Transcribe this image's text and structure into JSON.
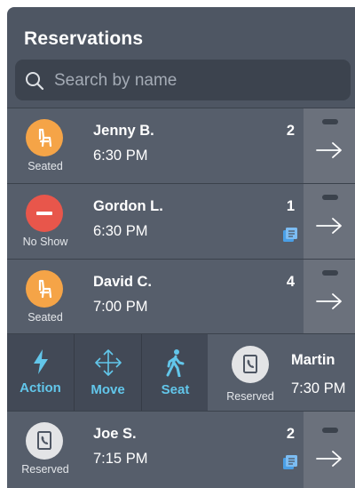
{
  "header": {
    "title": "Reservations"
  },
  "search": {
    "placeholder": "Search by name",
    "value": ""
  },
  "reservations": [
    {
      "name": "Jenny B.",
      "time": "6:30 PM",
      "party": "2",
      "status": "Seated",
      "status_icon": "chair-icon",
      "status_color": "#f5a447",
      "has_note": false
    },
    {
      "name": "Gordon L.",
      "time": "6:30 PM",
      "party": "1",
      "status": "No Show",
      "status_icon": "no-entry-icon",
      "status_color": "#e8564b",
      "has_note": true
    },
    {
      "name": "David C.",
      "time": "7:00 PM",
      "party": "4",
      "status": "Seated",
      "status_icon": "chair-icon",
      "status_color": "#f5a447",
      "has_note": false
    },
    {
      "name": "Joe S.",
      "time": "7:15 PM",
      "party": "2",
      "status": "Reserved",
      "status_icon": "phone-book-icon",
      "status_color": "#e3e4e6",
      "has_note": true
    }
  ],
  "swiped_row": {
    "actions": [
      {
        "label": "Action",
        "icon": "lightning-icon"
      },
      {
        "label": "Move",
        "icon": "move-arrows-icon"
      },
      {
        "label": "Seat",
        "icon": "walking-person-icon"
      }
    ],
    "name": "Martin",
    "time": "7:30 PM",
    "status": "Reserved",
    "status_icon": "phone-book-icon"
  },
  "colors": {
    "panel_bg": "#4e5663",
    "row_bg": "#565e6b",
    "action_accent": "#62c6ea",
    "note_accent": "#4a9fe6"
  }
}
